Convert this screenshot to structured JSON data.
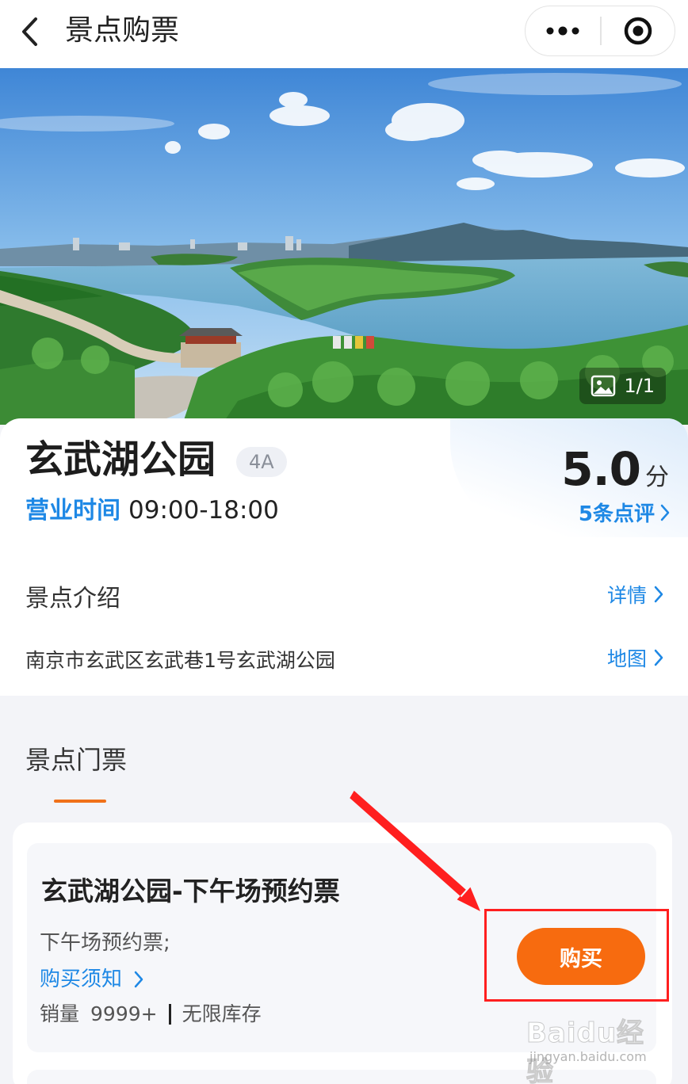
{
  "navbar": {
    "title": "景点购票"
  },
  "hero": {
    "photo_counter": "1/1"
  },
  "info": {
    "name": "玄武湖公园",
    "grade": "4A",
    "hours_label": "营业时间",
    "hours_value": "09:00-18:00",
    "score": "5.0",
    "score_unit": "分",
    "reviews_link": "5条点评",
    "intro_label": "景点介绍",
    "intro_link": "详情",
    "address": "南京市玄武区玄武巷1号玄武湖公园",
    "map_link": "地图"
  },
  "tickets": {
    "section_title": "景点门票",
    "items": [
      {
        "name": "玄武湖公园-下午场预约票",
        "desc": "下午场预约票;",
        "notice_link": "购买须知",
        "sales_label": "销量",
        "sales_value": "9999+",
        "stock": "无限库存",
        "buy_label": "购买"
      }
    ]
  },
  "watermark": {
    "brand": "Baidu经验",
    "url": "jingyan.baidu.com"
  },
  "colors": {
    "accent_blue": "#1e88e5",
    "buy_orange": "#f76b0f",
    "tab_underline": "#f0711a",
    "annotation_red": "#ff1f1f"
  }
}
